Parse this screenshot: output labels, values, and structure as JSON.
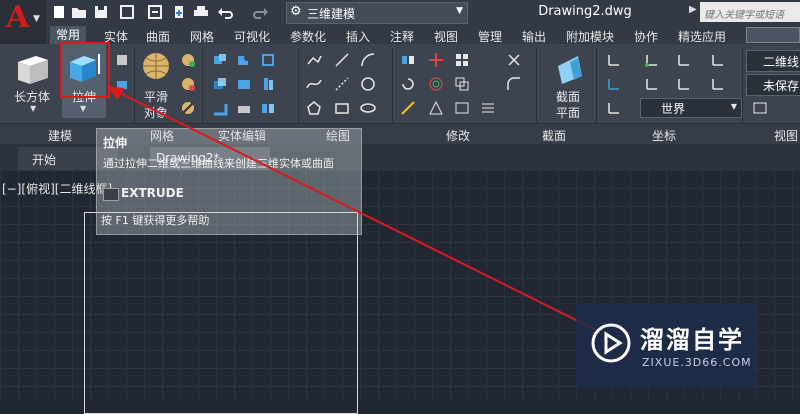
{
  "app": {
    "logo": "A"
  },
  "quick_access": [
    "new-icon",
    "open-icon",
    "save-icon",
    "saveas-icon",
    "save-web-icon",
    "share-icon",
    "print-icon",
    "undo-icon",
    "redo-icon"
  ],
  "workspace": {
    "label": "三维建模"
  },
  "document_title": "Drawing2.dwg",
  "search": {
    "placeholder": "键入关键字或短语"
  },
  "ribbon_tabs": [
    "常用",
    "实体",
    "曲面",
    "网格",
    "可视化",
    "参数化",
    "插入",
    "注释",
    "视图",
    "管理",
    "输出",
    "附加模块",
    "协作",
    "精选应用"
  ],
  "active_tab": "常用",
  "ribbon": {
    "box_label": "长方体",
    "extrude_label": "拉伸",
    "smooth_label_1": "平滑",
    "smooth_label_2": "对象",
    "section_label_1": "截面",
    "section_label_2": "平面",
    "world_label": "世界",
    "view_label_1": "二维线",
    "view_label_2": "未保存"
  },
  "panels": [
    "建模",
    "网格",
    "实体编辑",
    "绘图",
    "修改",
    "截面",
    "坐标",
    "视图"
  ],
  "tooltip": {
    "title": "拉伸",
    "description": "通过拉伸二维或三维曲线来创建三维实体或曲面",
    "command": "EXTRUDE",
    "help": "按 F1 键获得更多帮助"
  },
  "file_tabs": {
    "start": "开始",
    "drawing": "Drawing2*"
  },
  "viewport_label": "[−][俯视][二维线框]",
  "watermark": {
    "brand": "溜溜自学",
    "url": "ZIXUE.3D66.COM"
  },
  "colors": {
    "accent": "#e01818",
    "logo": "#d11c1c",
    "background": "#212833"
  }
}
